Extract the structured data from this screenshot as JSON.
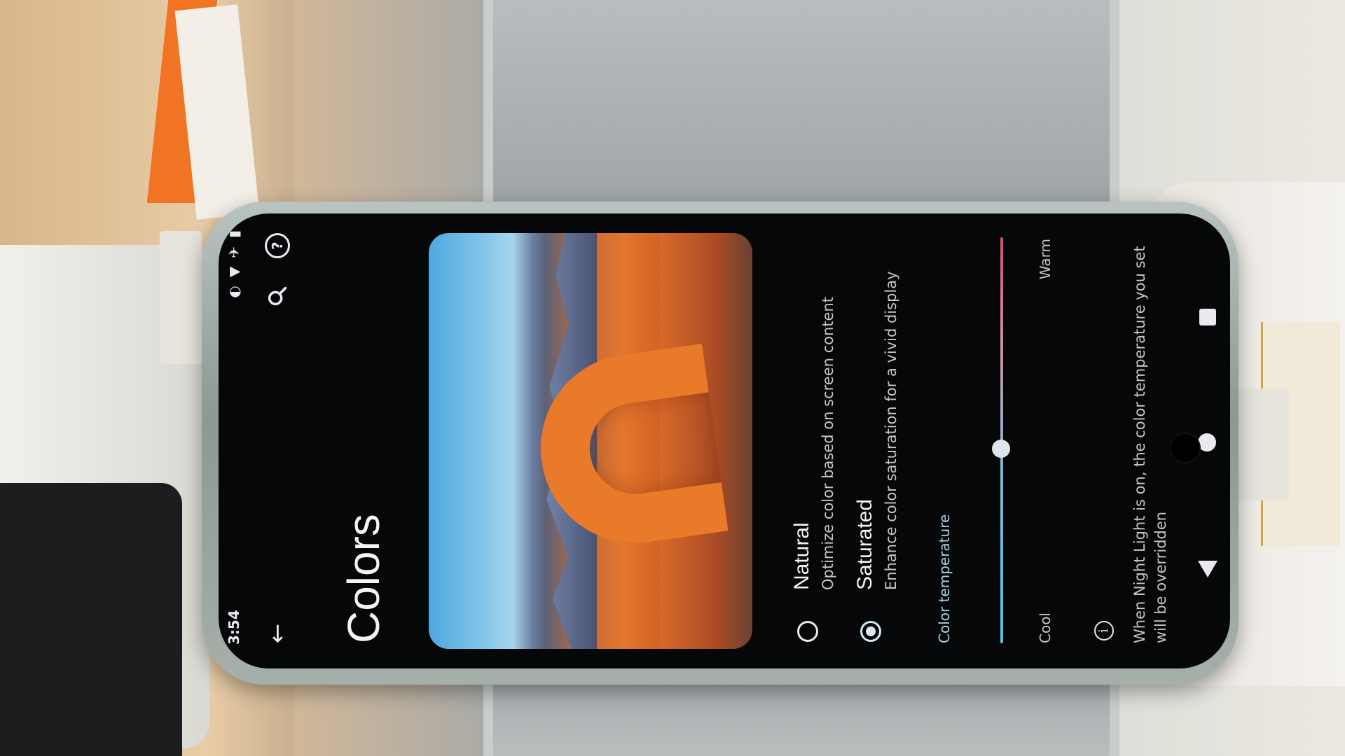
{
  "status_bar": {
    "time": "3:54",
    "icons": [
      "battery-icon",
      "airplane-icon",
      "wifi-icon",
      "data-saver-icon"
    ]
  },
  "toolbar": {
    "back_icon": "arrow-back-icon",
    "search_icon": "search-icon",
    "help_icon": "help-icon",
    "help_glyph": "?"
  },
  "page": {
    "title": "Colors"
  },
  "preview": {
    "description_icon": "landscape-preview"
  },
  "options": [
    {
      "title": "Natural",
      "subtitle": "Optimize color based on screen content",
      "checked": false
    },
    {
      "title": "Saturated",
      "subtitle": "Enhance color saturation for a vivid display",
      "checked": true
    }
  ],
  "color_temperature": {
    "label": "Color temperature",
    "min_label": "Cool",
    "max_label": "Warm",
    "value": 0.48
  },
  "info": {
    "icon": "info-icon",
    "glyph": "i",
    "text": "When Night Light is on, the color temperature you set will be overridden"
  },
  "nav_bar": {
    "icons": [
      "nav-back-icon",
      "nav-home-icon",
      "nav-recents-icon"
    ]
  }
}
